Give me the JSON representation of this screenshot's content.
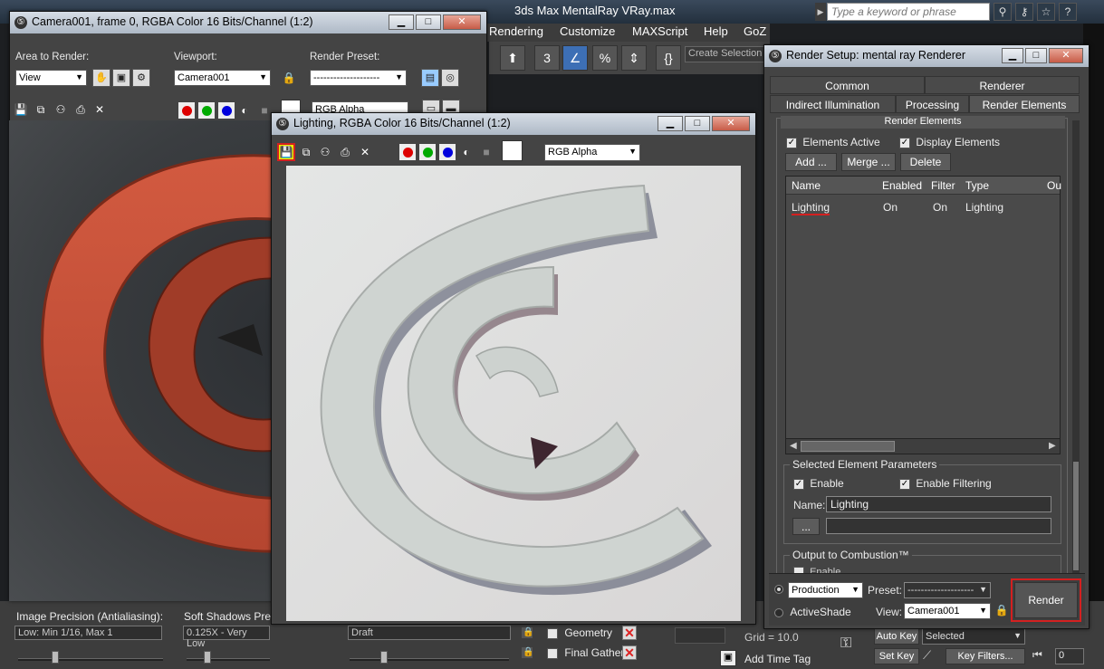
{
  "app": {
    "title": "3ds Max MentalRay VRay.max",
    "search_placeholder": "Type a keyword or phrase",
    "menu": [
      "Rendering",
      "Customize",
      "MAXScript",
      "Help",
      "GoZ"
    ],
    "selection_set": "Create Selection",
    "colors": {
      "accent_red": "#d42020",
      "window_title": "#c3ccd7",
      "panel": "#444444"
    }
  },
  "camera_window": {
    "title": "Camera001, frame 0, RGBA Color 16 Bits/Channel (1:2)",
    "area_label": "Area to Render:",
    "area_value": "View",
    "viewport_label": "Viewport:",
    "viewport_value": "Camera001",
    "preset_label": "Render Preset:",
    "preset_value": "--------------------",
    "channel_value": "RGB Alpha"
  },
  "lighting_window": {
    "title": "Lighting, RGBA Color 16 Bits/Channel (1:2)",
    "channel_value": "RGB Alpha"
  },
  "render_setup": {
    "title": "Render Setup: mental ray Renderer",
    "tabs_row1": [
      "Common",
      "Renderer"
    ],
    "tabs_row2": [
      "Indirect Illumination",
      "Processing",
      "Render Elements"
    ],
    "rollout_title": "Render Elements",
    "elements_active": "Elements Active",
    "display_elements": "Display Elements",
    "add_btn": "Add ...",
    "merge_btn": "Merge ...",
    "delete_btn": "Delete",
    "table_headers": [
      "Name",
      "Enabled",
      "Filter",
      "Type",
      "Ou"
    ],
    "rows": [
      {
        "name": "Lighting",
        "enabled": "On",
        "filter": "On",
        "type": "Lighting"
      }
    ],
    "selected_params_title": "Selected Element Parameters",
    "enable_label": "Enable",
    "enable_filtering_label": "Enable Filtering",
    "name_label": "Name:",
    "name_value": "Lighting",
    "browse_btn": "...",
    "path_value": "",
    "combustion_title": "Output to Combustion™",
    "combustion_enable": "Enable",
    "mode_production": "Production",
    "mode_activeshade": "ActiveShade",
    "preset_label": "Preset:",
    "preset_value": "--------------------",
    "view_label": "View:",
    "view_value": "Camera001",
    "render_btn": "Render"
  },
  "bottom": {
    "image_precision_label": "Image Precision (Antialiasing):",
    "image_precision_value": "Low: Min 1/16, Max 1",
    "soft_shadows_label": "Soft Shadows Precis",
    "soft_shadows_value": "0.125X - Very Low",
    "draft_value": "Draft",
    "geometry_label": "Geometry",
    "final_gather_label": "Final Gather",
    "grid_label": "Grid = 10.0",
    "add_time_tag": "Add Time Tag",
    "auto_key": "Auto Key",
    "set_key": "Set Key",
    "selected_value": "Selected",
    "key_filters": "Key Filters...",
    "frame_value": "0"
  }
}
